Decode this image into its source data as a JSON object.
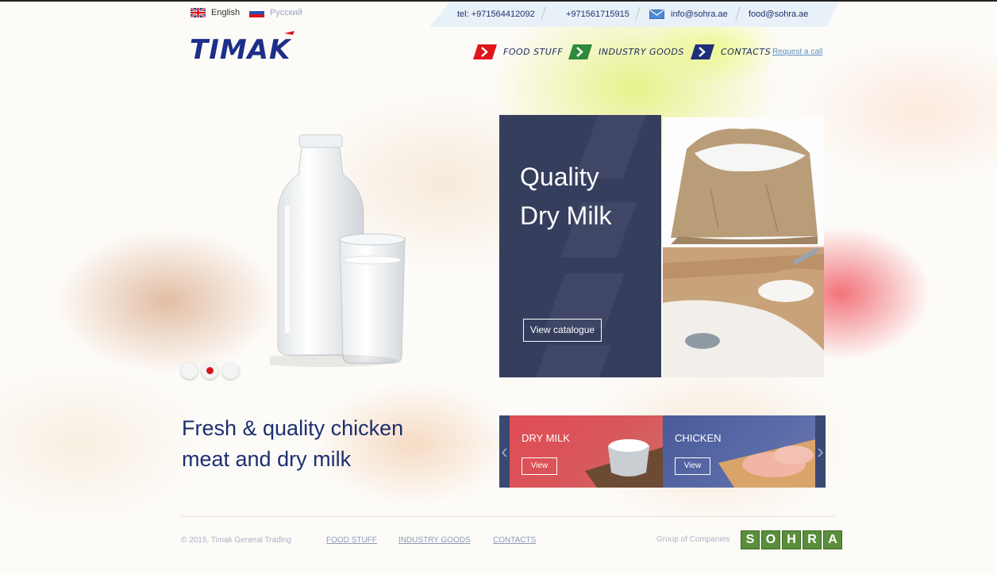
{
  "languages": [
    {
      "label": "English",
      "active": true
    },
    {
      "label": "Русский",
      "active": false
    }
  ],
  "contacts": {
    "phone1": "tel: +971564412092",
    "phone2": "+971561715915",
    "email1": "info@sohra.ae",
    "email2": "food@sohra.ae"
  },
  "logo": {
    "text": "TIMAK"
  },
  "nav": {
    "items": [
      {
        "label": "Food stuff",
        "color": "#e0151c"
      },
      {
        "label": "Industry goods",
        "color": "#2f8a3c"
      },
      {
        "label": "Contacts",
        "color": "#1f2f7a"
      }
    ],
    "request_call": "Request a call"
  },
  "slider": {
    "dots": 3,
    "active_dot": 2
  },
  "feature": {
    "title": "Quality\nDry Milk",
    "button": "View catalogue"
  },
  "tagline": "Fresh & quality chicken\nmeat and dry milk",
  "carousel": {
    "cards": [
      {
        "title": "DRY MILK",
        "button": "View"
      },
      {
        "title": "CHICKEN",
        "button": "View"
      }
    ]
  },
  "footer": {
    "copyright": "© 2015, Timak General Trading",
    "links": [
      "FOOD STUFF",
      "INDUSTRY GOODS",
      "CONTACTS"
    ],
    "group_text": "Group of Companies",
    "group_logo_letters": [
      "S",
      "O",
      "H",
      "R",
      "A"
    ]
  },
  "icons": [
    "uk-flag-icon",
    "russia-flag-icon",
    "mail-icon",
    "arrow-badge-icon",
    "chevron-left-icon",
    "chevron-right-icon"
  ],
  "colors": {
    "brand_blue": "#1d2f6f",
    "brand_red": "#d8141b",
    "panel": "#363e5e",
    "sohra_green": "#5a8e3c"
  }
}
